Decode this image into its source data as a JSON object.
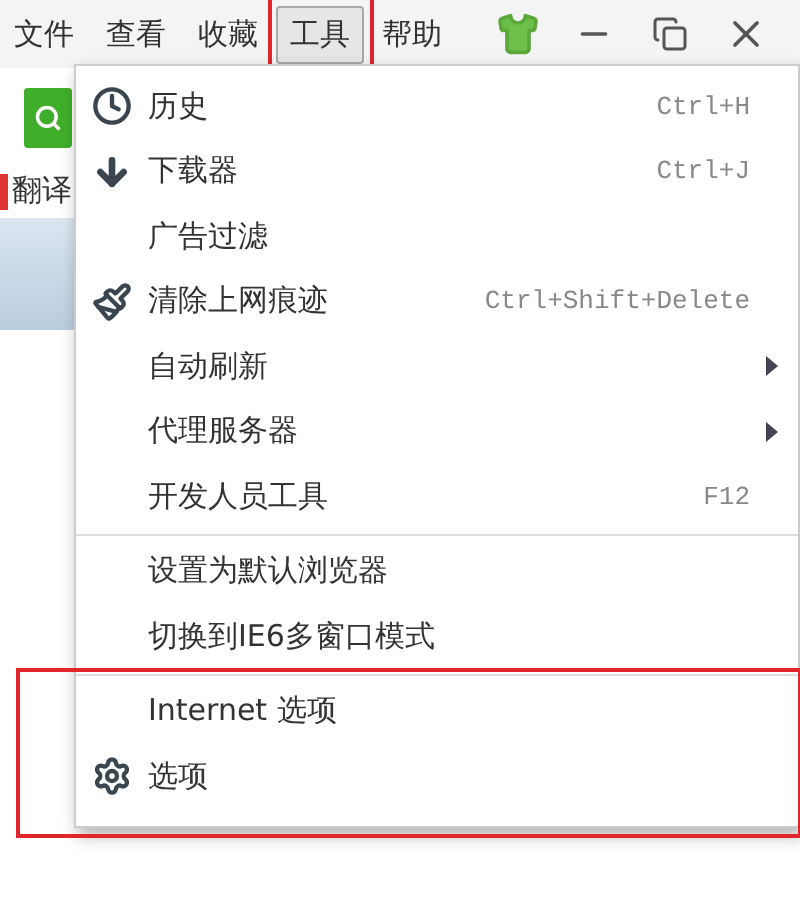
{
  "menubar": {
    "items": [
      {
        "label": "文件",
        "selected": false,
        "highlighted": false
      },
      {
        "label": "查看",
        "selected": false,
        "highlighted": false
      },
      {
        "label": "收藏",
        "selected": false,
        "highlighted": false
      },
      {
        "label": "工具",
        "selected": true,
        "highlighted": true
      },
      {
        "label": "帮助",
        "selected": false,
        "highlighted": false
      }
    ]
  },
  "toolbar": {
    "label": "翻译"
  },
  "menu": {
    "sections": [
      {
        "highlighted": false,
        "items": [
          {
            "label": "历史",
            "kind": "clock",
            "shortcut": "Ctrl+H",
            "submenu": false
          },
          {
            "label": "下载器",
            "kind": "download",
            "shortcut": "Ctrl+J",
            "submenu": false
          },
          {
            "label": "广告过滤",
            "kind": "plain",
            "submenu": false
          },
          {
            "label": "清除上网痕迹",
            "kind": "brush",
            "shortcut": "Ctrl+Shift+Delete",
            "submenu": false
          },
          {
            "label": "自动刷新",
            "kind": "plain",
            "submenu": true
          },
          {
            "label": "代理服务器",
            "kind": "plain",
            "submenu": true
          },
          {
            "label": "开发人员工具",
            "kind": "plain",
            "shortcut": "F12",
            "submenu": false
          }
        ]
      },
      {
        "highlighted": false,
        "items": [
          {
            "label": "设置为默认浏览器",
            "kind": "plain",
            "submenu": false
          },
          {
            "label": "切换到IE6多窗口模式",
            "kind": "plain",
            "submenu": false
          }
        ]
      },
      {
        "highlighted": true,
        "items": [
          {
            "label": "Internet 选项",
            "kind": "plain",
            "submenu": false
          },
          {
            "label": "选项",
            "kind": "gear",
            "submenu": false
          }
        ]
      }
    ]
  }
}
